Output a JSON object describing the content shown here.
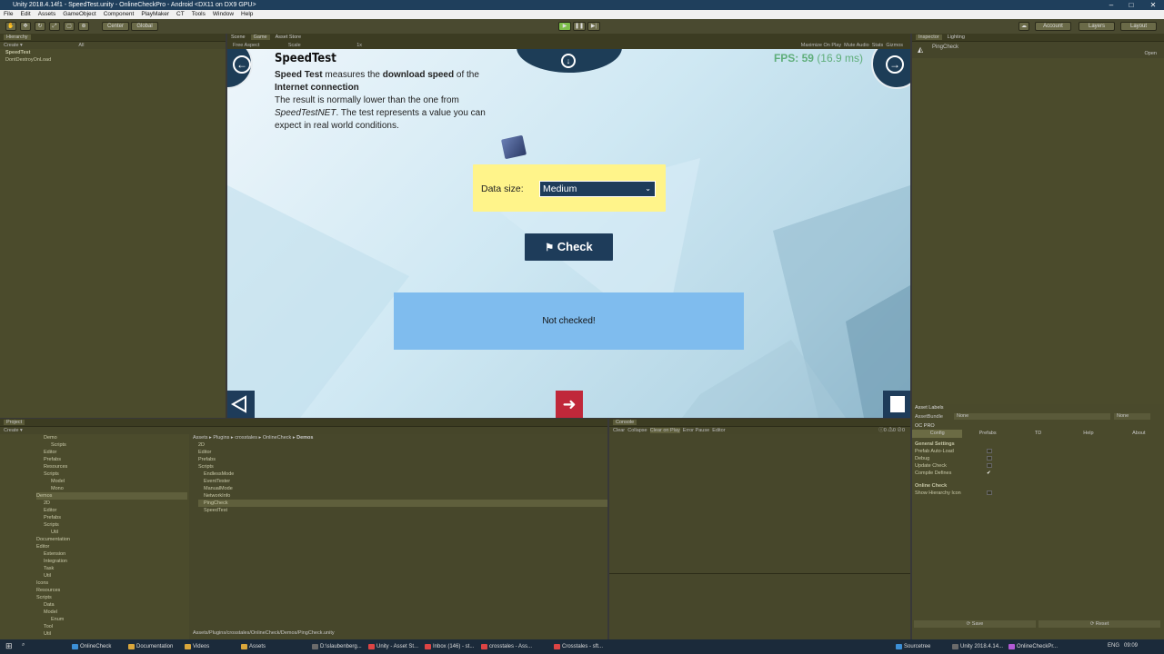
{
  "window": {
    "title": "Unity 2018.4.14f1 - SpeedTest.unity - OnlineCheckPro - Android <DX11 on DX9 GPU>"
  },
  "menu": [
    "File",
    "Edit",
    "Assets",
    "GameObject",
    "Component",
    "PlayMaker",
    "CT",
    "Tools",
    "Window",
    "Help"
  ],
  "toolbar": {
    "center": "Center",
    "global": "Global",
    "account": "Account",
    "layers": "Layers",
    "layout": "Layout"
  },
  "hierarchy": {
    "tab": "Hierarchy",
    "create": "Create",
    "all": "All",
    "items": [
      "SpeedTest",
      "DontDestroyOnLoad"
    ]
  },
  "scene_tabs": [
    "Scene",
    "Game",
    "Asset Store"
  ],
  "game_bar": {
    "aspect": "Free Aspect",
    "scale": "Scale",
    "scale_val": "1x",
    "opts": [
      "Maximize On Play",
      "Mute Audio",
      "Stats",
      "Gizmos"
    ]
  },
  "game": {
    "title": "SpeedTest",
    "desc": {
      "p1_a": "Speed Test",
      "p1_b": " measures the ",
      "p1_c": "download speed",
      "p1_d": " of the ",
      "p1_e": "Internet connection",
      ".": ".",
      "line3": "The result is normally lower than the one from",
      "line4a": "SpeedTestNET",
      "line4b": ". The test represents a value you can",
      "line5": "expect in real world conditions."
    },
    "fps_label": "FPS: 59",
    "fps_ms": "(16.9 ms)",
    "data_size_label": "Data size:",
    "data_size_value": "Medium",
    "check_label": "Check",
    "status_text": "Not checked!"
  },
  "inspector": {
    "tabs": [
      "Inspector",
      "Lighting"
    ],
    "object": "PingCheck",
    "open": "Open"
  },
  "asset_labels": {
    "title": "Asset Labels",
    "bundle": "AssetBundle",
    "none1": "None",
    "none2": "None",
    "oc": "OC PRO",
    "tabs": [
      "Config",
      "Prefabs",
      "TD",
      "Help",
      "About"
    ],
    "general": "General Settings",
    "settings": [
      "Prefab Auto-Load",
      "Debug",
      "Update Check",
      "Compile Defines"
    ],
    "online": "Online Check",
    "online_items": [
      "Show Hierarchy Icon"
    ],
    "save": "Save",
    "reset": "Reset"
  },
  "project": {
    "tab": "Project",
    "create": "Create",
    "tree": [
      "Demo",
      "Scripts",
      "Editor",
      "Prefabs",
      "Resources",
      "Scripts",
      "Model",
      "Mono",
      "Demos",
      "2D",
      "Editor",
      "Prefabs",
      "Scripts",
      "Util",
      "Documentation",
      "Editor",
      "Extension",
      "Integration",
      "Task",
      "Util",
      "Icons",
      "Resources",
      "Scripts",
      "Data",
      "Model",
      "Enum",
      "Tool",
      "Util"
    ],
    "breadcrumb": [
      "Assets",
      "Plugins",
      "crosstales",
      "OnlineCheck",
      "Demos"
    ],
    "files": [
      "2D",
      "Editor",
      "Prefabs",
      "Scripts",
      "EndlessMode",
      "EventTester",
      "ManualMode",
      "NetworkInfo",
      "PingCheck",
      "SpeedTest"
    ],
    "path": "Assets/Plugins/crosstales/OnlineCheck/Demos/PingCheck.unity"
  },
  "console": {
    "tab": "Console",
    "buttons": [
      "Clear",
      "Collapse",
      "Clear on Play",
      "Error Pause",
      "Editor"
    ],
    "counts": [
      "0",
      "0",
      "0"
    ]
  },
  "taskbar": {
    "items": [
      "OnlineCheck",
      "Documentation",
      "Videos",
      "Assets",
      "D:\\slaubenberg...",
      "Unity - Asset St...",
      "Inbox (146) - st...",
      "crosstales - Ass...",
      "Crosstales - sft...",
      "Sourcetree",
      "Unity 2018.4.14...",
      "OnlineCheckPr..."
    ],
    "time": "09:09",
    "lang": "ENG"
  }
}
